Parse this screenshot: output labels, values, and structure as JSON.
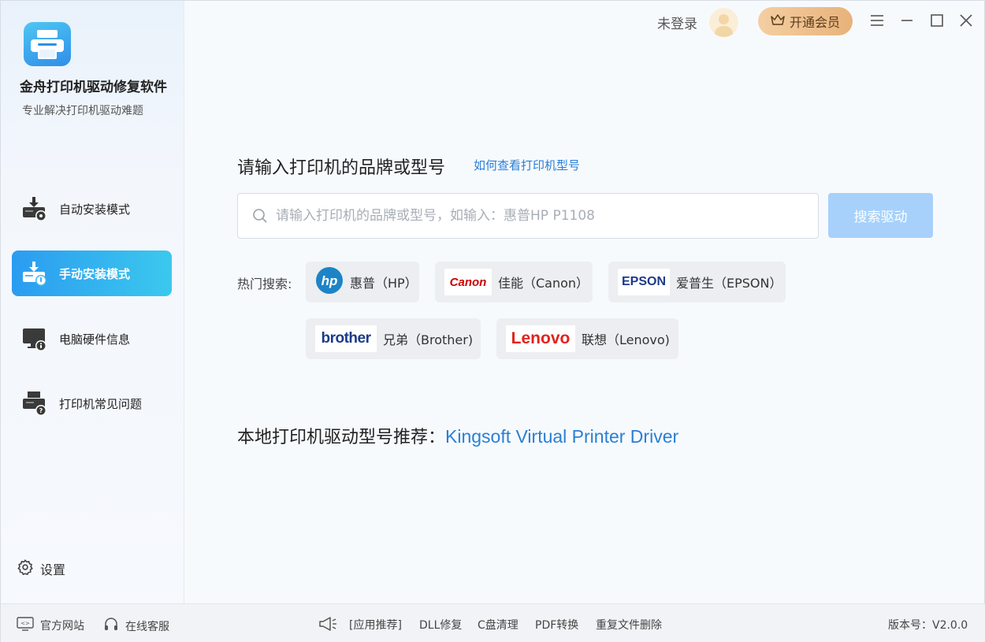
{
  "app": {
    "title": "金舟打印机驱动修复软件",
    "subtitle": "专业解决打印机驱动难题"
  },
  "sidebar": {
    "items": [
      {
        "label": "自动安装模式",
        "icon": "printer-download-gear-icon",
        "active": false
      },
      {
        "label": "手动安装模式",
        "icon": "printer-download-hand-icon",
        "active": true
      },
      {
        "label": "电脑硬件信息",
        "icon": "monitor-info-icon",
        "active": false
      },
      {
        "label": "打印机常见问题",
        "icon": "printer-question-icon",
        "active": false
      }
    ],
    "settings_label": "设置"
  },
  "topbar": {
    "user_status": "未登录",
    "vip_label": "开通会员"
  },
  "main": {
    "heading": "请输入打印机的品牌或型号",
    "help_link": "如何查看打印机型号",
    "search_placeholder": "请输入打印机的品牌或型号，如输入：惠普HP P1108",
    "search_value": "",
    "search_button": "搜索驱动",
    "hot_label": "热门搜索:",
    "brands": [
      {
        "logo": "hp",
        "name": "惠普（HP）"
      },
      {
        "logo": "Canon",
        "name": "佳能（Canon）"
      },
      {
        "logo": "EPSON",
        "name": "爱普生（EPSON）"
      },
      {
        "logo": "brother",
        "name": "兄弟（Brother)"
      },
      {
        "logo": "Lenovo",
        "name": "联想（Lenovo)"
      }
    ],
    "recommend_label": "本地打印机驱动型号推荐：",
    "recommend_value": "Kingsoft Virtual Printer Driver"
  },
  "footer": {
    "website": "官方网站",
    "support": "在线客服",
    "apps_label": "[应用推荐]",
    "apps": [
      "DLL修复",
      "C盘清理",
      "PDF转换",
      "重复文件删除"
    ],
    "version": "版本号：V2.0.0"
  },
  "colors": {
    "accent": "#2b9cf0",
    "link": "#2a7fd6",
    "search_button": "#a7d1fb",
    "vip": "#e8b27a"
  }
}
